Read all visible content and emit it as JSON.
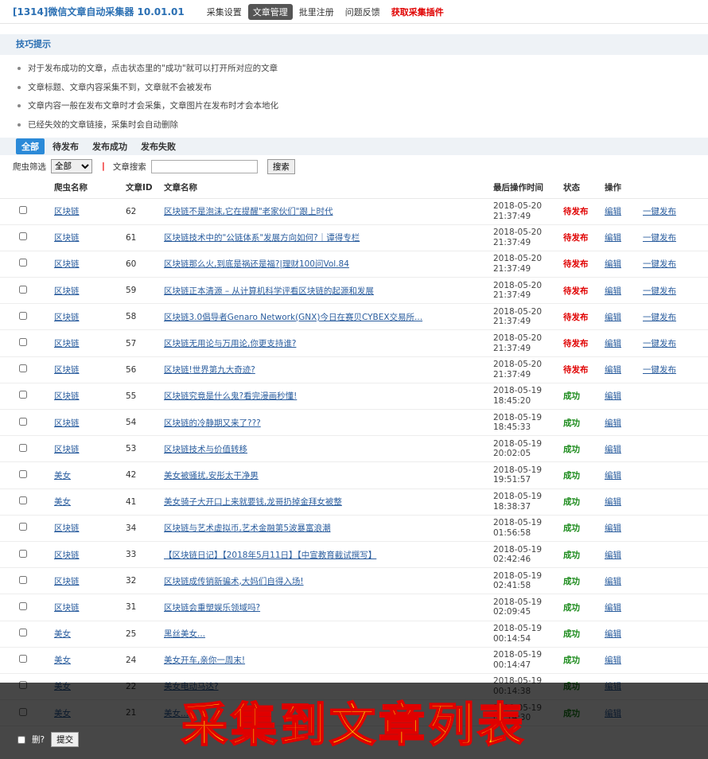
{
  "app": {
    "title": "[1314]微信文章自动采集器 10.01.01",
    "nav": [
      "采集设置",
      "文章管理",
      "批里注册",
      "问题反馈",
      "获取采集插件"
    ]
  },
  "tips": {
    "heading": "技巧提示",
    "items": [
      "对于发布成功的文章，点击状态里的\"成功\"就可以打开所对应的文章",
      "文章标题、文章内容采集不到，文章就不会被发布",
      "文章内容一般在发布文章时才会采集，文章图片在发布时才会本地化",
      "已经失效的文章链接，采集时会自动删除"
    ]
  },
  "status_tabs": [
    "全部",
    "待发布",
    "发布成功",
    "发布失败"
  ],
  "filter": {
    "crawler_label": "爬虫筛选",
    "crawler_value": "全部",
    "search_label": "文章搜索",
    "search_button": "搜索"
  },
  "table": {
    "headers": [
      "爬虫名称",
      "文章ID",
      "文章名称",
      "最后操作时间",
      "状态",
      "操作"
    ],
    "rows": [
      {
        "crawler": "区块链",
        "id": "62",
        "title": "区块链不是泡沫,它在提醒\"老家伙们\"跟上时代",
        "date": "2018-05-20",
        "time": "21:37:49",
        "status": "待发布",
        "edit": "编辑",
        "publish": "一键发布"
      },
      {
        "crawler": "区块链",
        "id": "61",
        "title": "区块链技术中的\"公链体系\"发展方向如何?｜谭得专栏",
        "date": "2018-05-20",
        "time": "21:37:49",
        "status": "待发布",
        "edit": "编辑",
        "publish": "一键发布"
      },
      {
        "crawler": "区块链",
        "id": "60",
        "title": "区块链那么火,到底是祸还是福?|理财100问Vol.84",
        "date": "2018-05-20",
        "time": "21:37:49",
        "status": "待发布",
        "edit": "编辑",
        "publish": "一键发布"
      },
      {
        "crawler": "区块链",
        "id": "59",
        "title": "区块链正本清源 – 从计算机科学评看区块链的起源和发展",
        "date": "2018-05-20",
        "time": "21:37:49",
        "status": "待发布",
        "edit": "编辑",
        "publish": "一键发布"
      },
      {
        "crawler": "区块链",
        "id": "58",
        "title": "区块链3.0倡导者Genaro Network(GNX)今日在赛贝CYBEX交易所...",
        "date": "2018-05-20",
        "time": "21:37:49",
        "status": "待发布",
        "edit": "编辑",
        "publish": "一键发布"
      },
      {
        "crawler": "区块链",
        "id": "57",
        "title": "区块链无用论与万用论,你更支持谁?",
        "date": "2018-05-20",
        "time": "21:37:49",
        "status": "待发布",
        "edit": "编辑",
        "publish": "一键发布"
      },
      {
        "crawler": "区块链",
        "id": "56",
        "title": "区块链!世界第九大奇迹?",
        "date": "2018-05-20",
        "time": "21:37:49",
        "status": "待发布",
        "edit": "编辑",
        "publish": "一键发布"
      },
      {
        "crawler": "区块链",
        "id": "55",
        "title": "区块链究竟是什么鬼?看完漫画秒懂!",
        "date": "2018-05-19",
        "time": "18:45:20",
        "status": "成功",
        "edit": "编辑",
        "publish": ""
      },
      {
        "crawler": "区块链",
        "id": "54",
        "title": "区块链的冷静期又来了???",
        "date": "2018-05-19",
        "time": "18:45:33",
        "status": "成功",
        "edit": "编辑",
        "publish": ""
      },
      {
        "crawler": "区块链",
        "id": "53",
        "title": "区块链技术与价值转移",
        "date": "2018-05-19",
        "time": "20:02:05",
        "status": "成功",
        "edit": "编辑",
        "publish": ""
      },
      {
        "crawler": "美女",
        "id": "42",
        "title": "美女被骚扰,安彤太干净男",
        "date": "2018-05-19",
        "time": "19:51:57",
        "status": "成功",
        "edit": "编辑",
        "publish": ""
      },
      {
        "crawler": "美女",
        "id": "41",
        "title": "美女骑子大开口上来就要钱,龙哥扔掉金拜女被整",
        "date": "2018-05-19",
        "time": "18:38:37",
        "status": "成功",
        "edit": "编辑",
        "publish": ""
      },
      {
        "crawler": "区块链",
        "id": "34",
        "title": "区块链与艺术虚拟币,艺术金融第5波暴富浪潮",
        "date": "2018-05-19",
        "time": "01:56:58",
        "status": "成功",
        "edit": "编辑",
        "publish": ""
      },
      {
        "crawler": "区块链",
        "id": "33",
        "title": "【区块链日记】【2018年5月11日】【中宣教育截试撰写】",
        "date": "2018-05-19",
        "time": "02:42:46",
        "status": "成功",
        "edit": "编辑",
        "publish": ""
      },
      {
        "crawler": "区块链",
        "id": "32",
        "title": "区块链成传销新骗术,大妈们自得入场!",
        "date": "2018-05-19",
        "time": "02:41:58",
        "status": "成功",
        "edit": "编辑",
        "publish": ""
      },
      {
        "crawler": "区块链",
        "id": "31",
        "title": "区块链会重塑娱乐领域吗?",
        "date": "2018-05-19",
        "time": "02:09:45",
        "status": "成功",
        "edit": "编辑",
        "publish": ""
      },
      {
        "crawler": "美女",
        "id": "25",
        "title": "黑丝美女...",
        "date": "2018-05-19",
        "time": "00:14:54",
        "status": "成功",
        "edit": "编辑",
        "publish": ""
      },
      {
        "crawler": "美女",
        "id": "24",
        "title": "美女开车,亲你一周末!",
        "date": "2018-05-19",
        "time": "00:14:47",
        "status": "成功",
        "edit": "编辑",
        "publish": ""
      },
      {
        "crawler": "美女",
        "id": "22",
        "title": "美女电动马达?",
        "date": "2018-05-19",
        "time": "00:14:38",
        "status": "成功",
        "edit": "编辑",
        "publish": ""
      },
      {
        "crawler": "美女",
        "id": "21",
        "title": "美女...",
        "date": "2018-05-19",
        "time": "00:14:30",
        "status": "成功",
        "edit": "编辑",
        "publish": ""
      }
    ]
  },
  "footer": {
    "delete_label": "删?",
    "submit_label": "提交"
  },
  "banner": {
    "text": "采集到文章列表"
  }
}
